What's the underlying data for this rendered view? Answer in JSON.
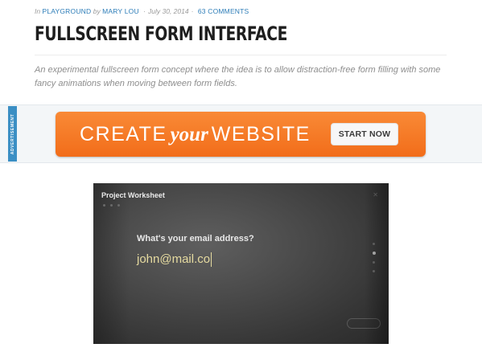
{
  "meta": {
    "in_label": "In",
    "category": "PLAYGROUND",
    "by_label": "by",
    "author": "MARY LOU",
    "date": "July 30, 2014",
    "separator": "·",
    "comments": "63 COMMENTS"
  },
  "article": {
    "title": "FULLSCREEN FORM INTERFACE",
    "excerpt": "An experimental fullscreen form concept where the idea is to allow distraction-free form filling with some fancy animations when moving between form fields."
  },
  "ad": {
    "tag": "ADVERTISEMENT",
    "text_left": "CREATE",
    "text_mid": "your",
    "text_right": "WEBSITE",
    "button_label": "START NOW",
    "colors": {
      "banner": "#f57c22",
      "tag": "#3b8fc4"
    }
  },
  "demo": {
    "header_title": "Project Worksheet",
    "question": "What's your email address?",
    "answer_value": "john@mail.co",
    "nav_dots": 4,
    "active_dot": 1
  }
}
